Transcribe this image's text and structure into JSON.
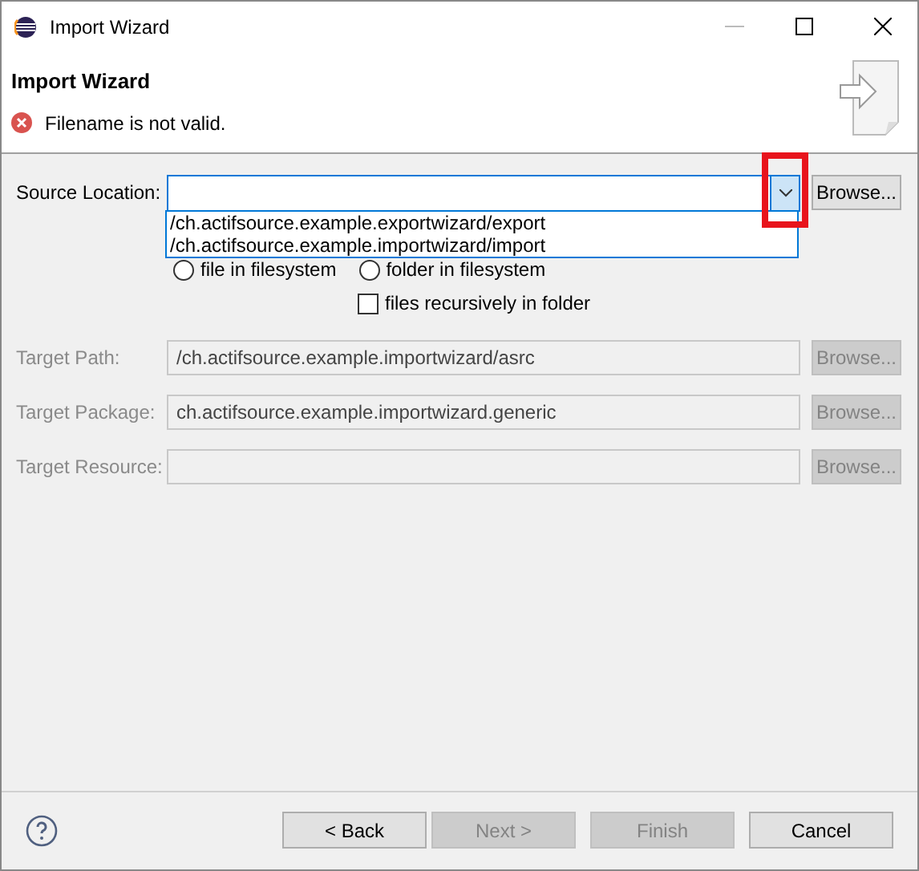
{
  "window": {
    "title": "Import Wizard"
  },
  "header": {
    "title": "Import Wizard",
    "message": "Filename is not valid."
  },
  "source": {
    "label": "Source Location:",
    "browse": "Browse...",
    "dropdown_open": true,
    "options": [
      "/ch.actifsource.example.exportwizard/export",
      "/ch.actifsource.example.importwizard/import"
    ]
  },
  "mode": [
    {
      "label": "file in filesystem",
      "selected": false
    },
    {
      "label": "folder in filesystem",
      "selected": false
    }
  ],
  "recursive": {
    "label": "files recursively in folder",
    "checked": false
  },
  "targets": [
    {
      "label": "Target Path:",
      "value": "/ch.actifsource.example.importwizard/asrc",
      "browse": "Browse...",
      "disabled": true
    },
    {
      "label": "Target Package:",
      "value": "ch.actifsource.example.importwizard.generic",
      "browse": "Browse...",
      "disabled": true
    },
    {
      "label": "Target Resource:",
      "browse": "Browse...",
      "disabled": true
    }
  ],
  "buttons": [
    {
      "label": "< Back",
      "disabled": false
    },
    {
      "label": "Next >",
      "disabled": true
    },
    {
      "label": "Finish",
      "disabled": true
    },
    {
      "label": "Cancel",
      "disabled": false
    }
  ]
}
